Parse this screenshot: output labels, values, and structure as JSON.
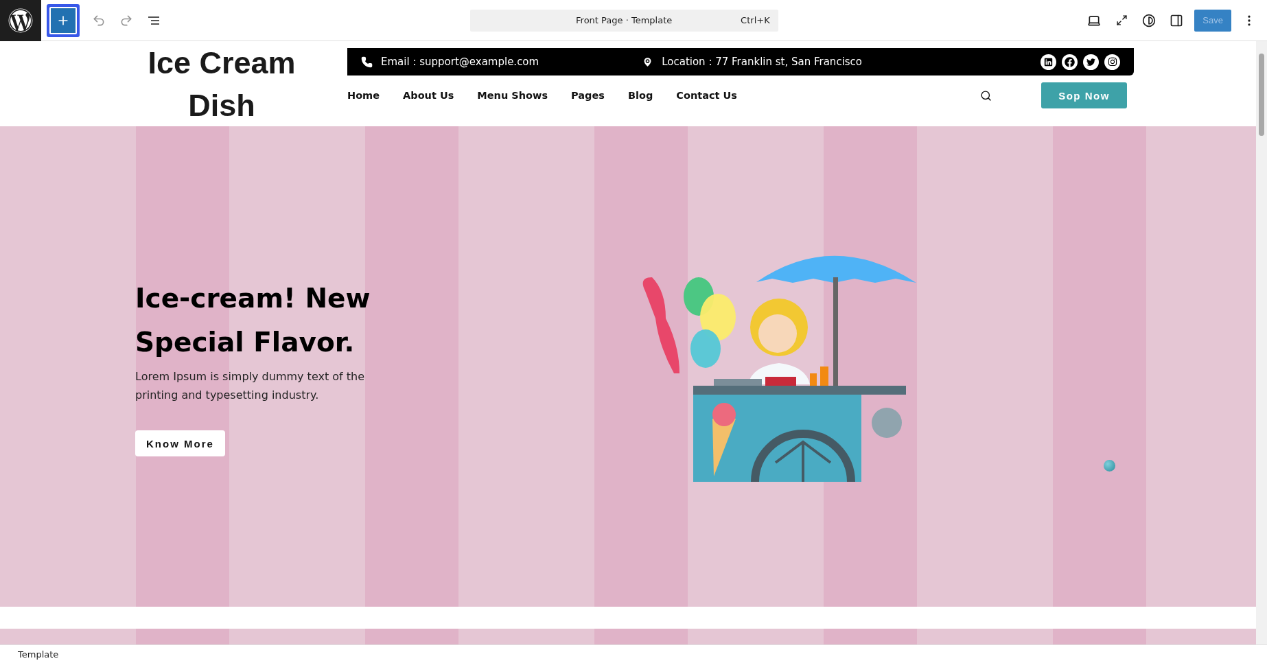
{
  "toolbar": {
    "inserter_active": true,
    "command_bar": {
      "title": "Front Page · Template",
      "shortcut": "Ctrl+K"
    },
    "save": {
      "label": "Save",
      "disabled": true
    }
  },
  "site": {
    "title": "Ice Cream Dish",
    "email": "Email : support@example.com",
    "location": "Location : 77 Franklin st, San Francisco",
    "nav": [
      "Home",
      "About Us",
      "Menu Shows",
      "Pages",
      "Blog",
      "Contact Us"
    ],
    "cta": "Sop Now"
  },
  "hero": {
    "heading": "Ice-cream! New Special Flavor.",
    "text": "Lorem Ipsum is simply dummy text of the printing and typesetting industry.",
    "button": "Know More"
  },
  "status_bar": "Template"
}
